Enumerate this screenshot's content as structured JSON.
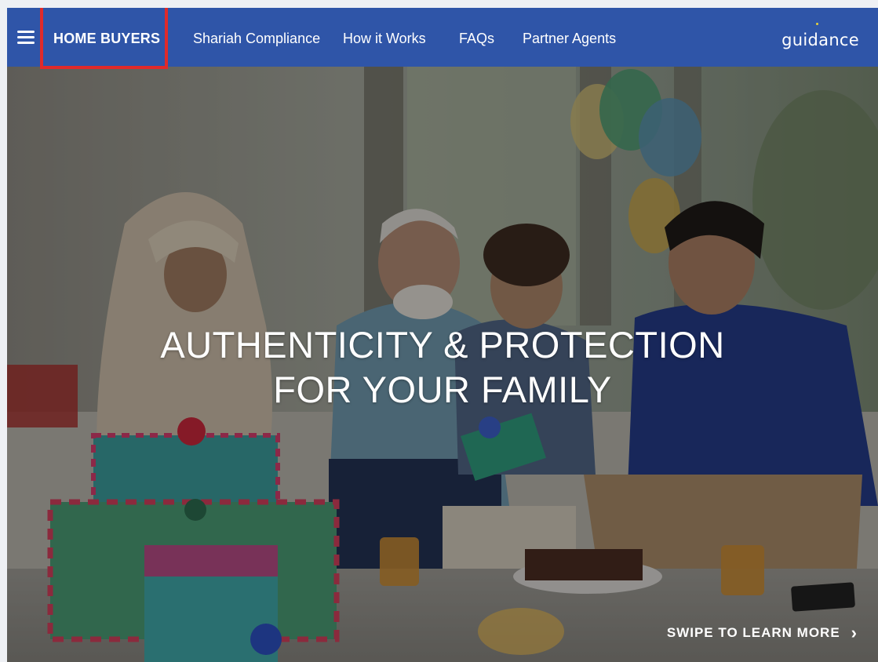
{
  "nav": {
    "menu_icon": "hamburger-menu-icon",
    "items": [
      {
        "label": "HOME BUYERS"
      },
      {
        "label": "Shariah Compliance"
      },
      {
        "label": "How it Works"
      },
      {
        "label": "FAQs"
      },
      {
        "label": "Partner Agents"
      }
    ],
    "brand": "guidance"
  },
  "hero": {
    "title_line1": "AUTHENTICITY & PROTECTION",
    "title_line2": "FOR YOUR FAMILY",
    "cta": "SWIPE TO LEARN MORE",
    "cta_icon": "chevron-right-icon"
  },
  "colors": {
    "nav_background": "#2f55a8",
    "highlight": "#e02a2a",
    "brand_dot": "#e8d23a"
  }
}
